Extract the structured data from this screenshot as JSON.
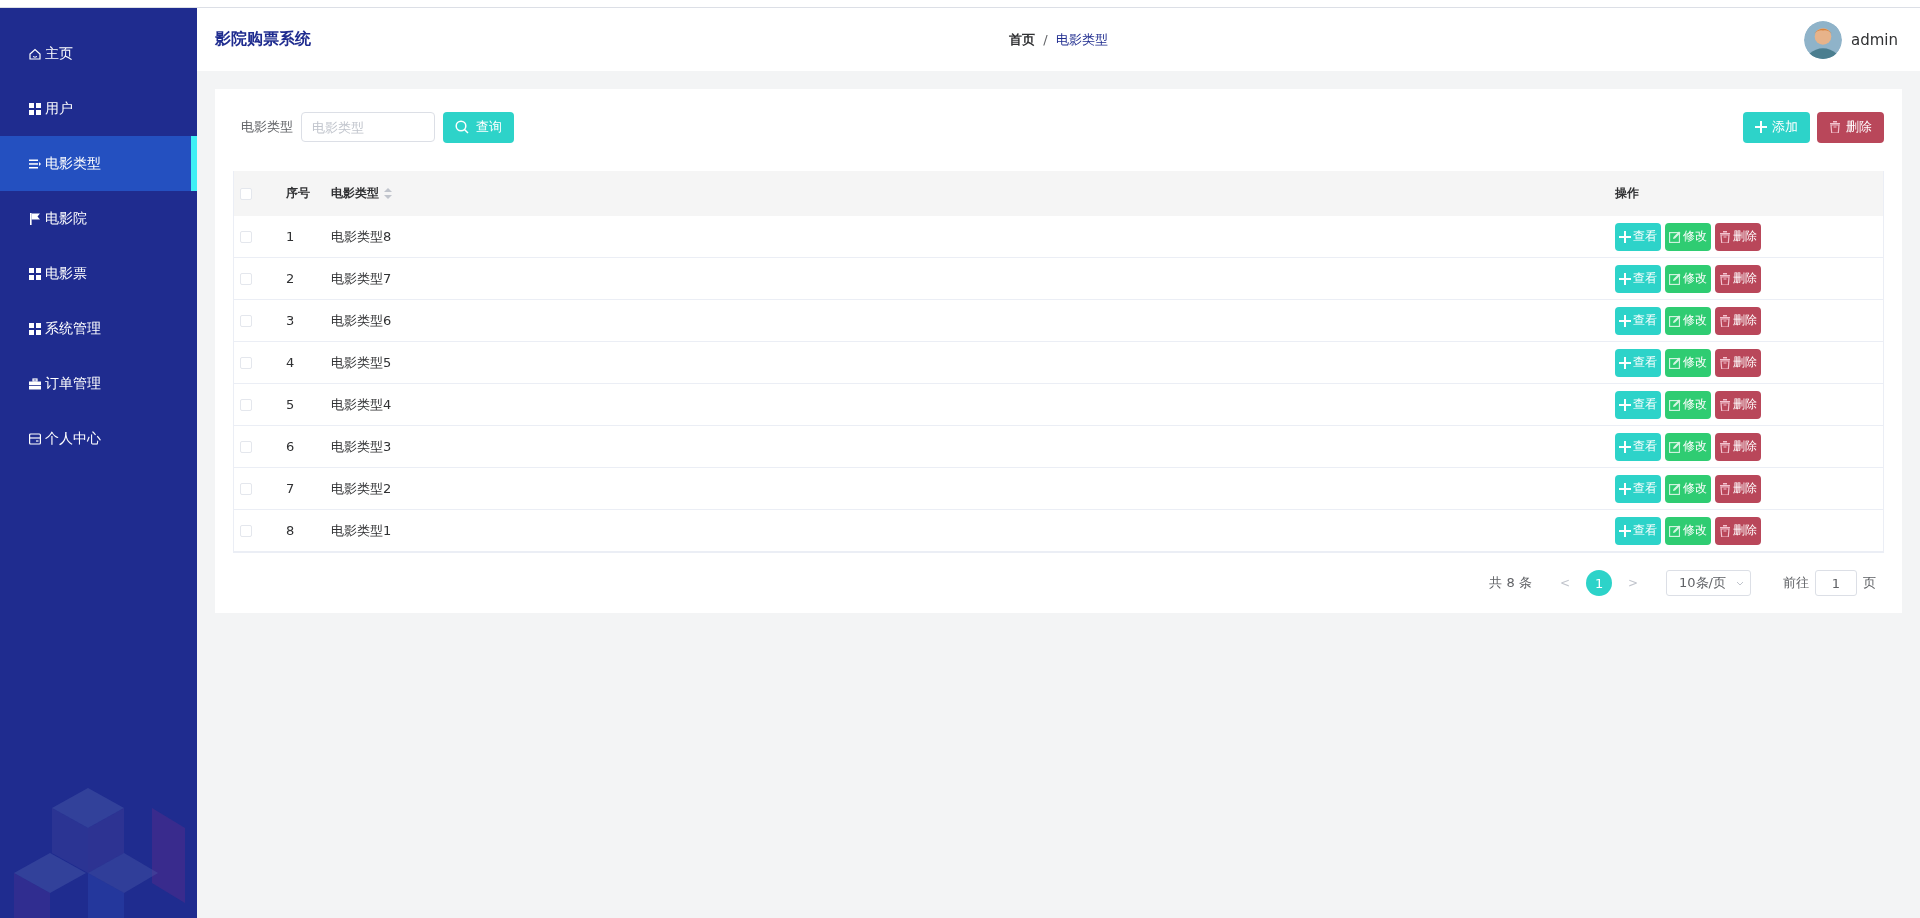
{
  "sidebar": {
    "items": [
      {
        "label": "主页",
        "selected": false
      },
      {
        "label": "用户",
        "selected": false
      },
      {
        "label": "电影类型",
        "selected": true
      },
      {
        "label": "电影院",
        "selected": false
      },
      {
        "label": "电影票",
        "selected": false
      },
      {
        "label": "系统管理",
        "selected": false
      },
      {
        "label": "订单管理",
        "selected": false
      },
      {
        "label": "个人中心",
        "selected": false
      }
    ]
  },
  "header": {
    "title": "影院购票系统",
    "breadcrumb": {
      "home": "首页",
      "separator": "/",
      "current": "电影类型"
    },
    "user": "admin"
  },
  "search": {
    "label": "电影类型",
    "placeholder": "电影类型",
    "button": "查询"
  },
  "actions": [
    {
      "label": "添加",
      "kind": "add"
    },
    {
      "label": "删除",
      "kind": "delete"
    }
  ],
  "table": {
    "header_checked": false,
    "columns": [
      "序号",
      "电影类型",
      "操作"
    ],
    "rows": [
      {
        "checked": false,
        "index": "1",
        "type": "电影类型8",
        "actions": [
          {
            "label": "查看",
            "kind": "view"
          },
          {
            "label": "修改",
            "kind": "edit"
          },
          {
            "label": "删除",
            "kind": "delete"
          }
        ]
      },
      {
        "checked": false,
        "index": "2",
        "type": "电影类型7",
        "actions": [
          {
            "label": "查看",
            "kind": "view"
          },
          {
            "label": "修改",
            "kind": "edit"
          },
          {
            "label": "删除",
            "kind": "delete"
          }
        ]
      },
      {
        "checked": false,
        "index": "3",
        "type": "电影类型6",
        "actions": [
          {
            "label": "查看",
            "kind": "view"
          },
          {
            "label": "修改",
            "kind": "edit"
          },
          {
            "label": "删除",
            "kind": "delete"
          }
        ]
      },
      {
        "checked": false,
        "index": "4",
        "type": "电影类型5",
        "actions": [
          {
            "label": "查看",
            "kind": "view"
          },
          {
            "label": "修改",
            "kind": "edit"
          },
          {
            "label": "删除",
            "kind": "delete"
          }
        ]
      },
      {
        "checked": false,
        "index": "5",
        "type": "电影类型4",
        "actions": [
          {
            "label": "查看",
            "kind": "view"
          },
          {
            "label": "修改",
            "kind": "edit"
          },
          {
            "label": "删除",
            "kind": "delete"
          }
        ]
      },
      {
        "checked": false,
        "index": "6",
        "type": "电影类型3",
        "actions": [
          {
            "label": "查看",
            "kind": "view"
          },
          {
            "label": "修改",
            "kind": "edit"
          },
          {
            "label": "删除",
            "kind": "delete"
          }
        ]
      },
      {
        "checked": false,
        "index": "7",
        "type": "电影类型2",
        "actions": [
          {
            "label": "查看",
            "kind": "view"
          },
          {
            "label": "修改",
            "kind": "edit"
          },
          {
            "label": "删除",
            "kind": "delete"
          }
        ]
      },
      {
        "checked": false,
        "index": "8",
        "type": "电影类型1",
        "actions": [
          {
            "label": "查看",
            "kind": "view"
          },
          {
            "label": "修改",
            "kind": "edit"
          },
          {
            "label": "删除",
            "kind": "delete"
          }
        ]
      }
    ]
  },
  "pagination": {
    "total": "共 8 条",
    "prev": "<",
    "pages": [
      {
        "label": "1",
        "selected": true
      }
    ],
    "next": ">",
    "page_size": "10条/页",
    "goto_label": "前往",
    "goto_value": "1",
    "page_suffix": "页"
  }
}
